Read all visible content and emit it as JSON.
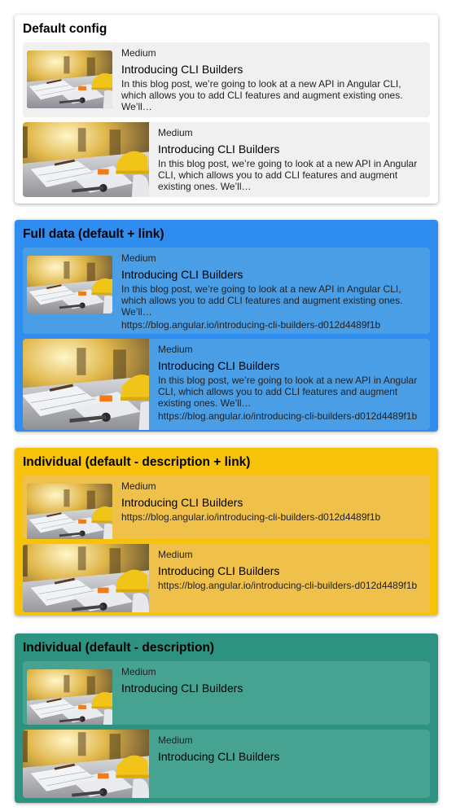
{
  "sections": [
    {
      "title": "Default config",
      "bg": "#ffffff",
      "card_bg": "#f0f0f0",
      "cards": [
        {
          "layout": "small",
          "source": "Medium",
          "title": "Introducing CLI Builders",
          "description": "In this blog post, we’re going to look at a new API in Angular CLI, which allows you to add CLI features and augment existing ones. We’ll…"
        },
        {
          "layout": "large",
          "source": "Medium",
          "title": "Introducing CLI Builders",
          "description": "In this blog post, we’re going to look at a new API in Angular CLI, which allows you to add CLI features and augment existing ones. We’ll…"
        }
      ]
    },
    {
      "title": "Full data (default + link)",
      "bg": "#2f8df0",
      "card_bg": "#4a9ee6",
      "cards": [
        {
          "layout": "small",
          "source": "Medium",
          "title": "Introducing CLI Builders",
          "description": "In this blog post, we’re going to look at a new API in Angular CLI, which allows you to add CLI features and augment existing ones. We’ll…",
          "link": "https://blog.angular.io/introducing-cli-builders-d012d4489f1b"
        },
        {
          "layout": "large",
          "source": "Medium",
          "title": "Introducing CLI Builders",
          "description": "In this blog post, we’re going to look at a new API in Angular CLI, which allows you to add CLI features and augment existing ones. We’ll…",
          "link": "https://blog.angular.io/introducing-cli-builders-d012d4489f1b"
        }
      ]
    },
    {
      "title": "Individual (default - description + link)",
      "bg": "#f6c20a",
      "card_bg": "#efc04a",
      "cards": [
        {
          "layout": "small",
          "source": "Medium",
          "title": "Introducing CLI Builders",
          "link": "https://blog.angular.io/introducing-cli-builders-d012d4489f1b"
        },
        {
          "layout": "large",
          "source": "Medium",
          "title": "Introducing CLI Builders",
          "link": "https://blog.angular.io/introducing-cli-builders-d012d4489f1b"
        }
      ]
    },
    {
      "title": "Individual (default - description)",
      "bg": "#2e9280",
      "card_bg": "#46a392",
      "cards": [
        {
          "layout": "small",
          "source": "Medium",
          "title": "Introducing CLI Builders"
        },
        {
          "layout": "large",
          "source": "Medium",
          "title": "Introducing CLI Builders"
        }
      ]
    }
  ]
}
